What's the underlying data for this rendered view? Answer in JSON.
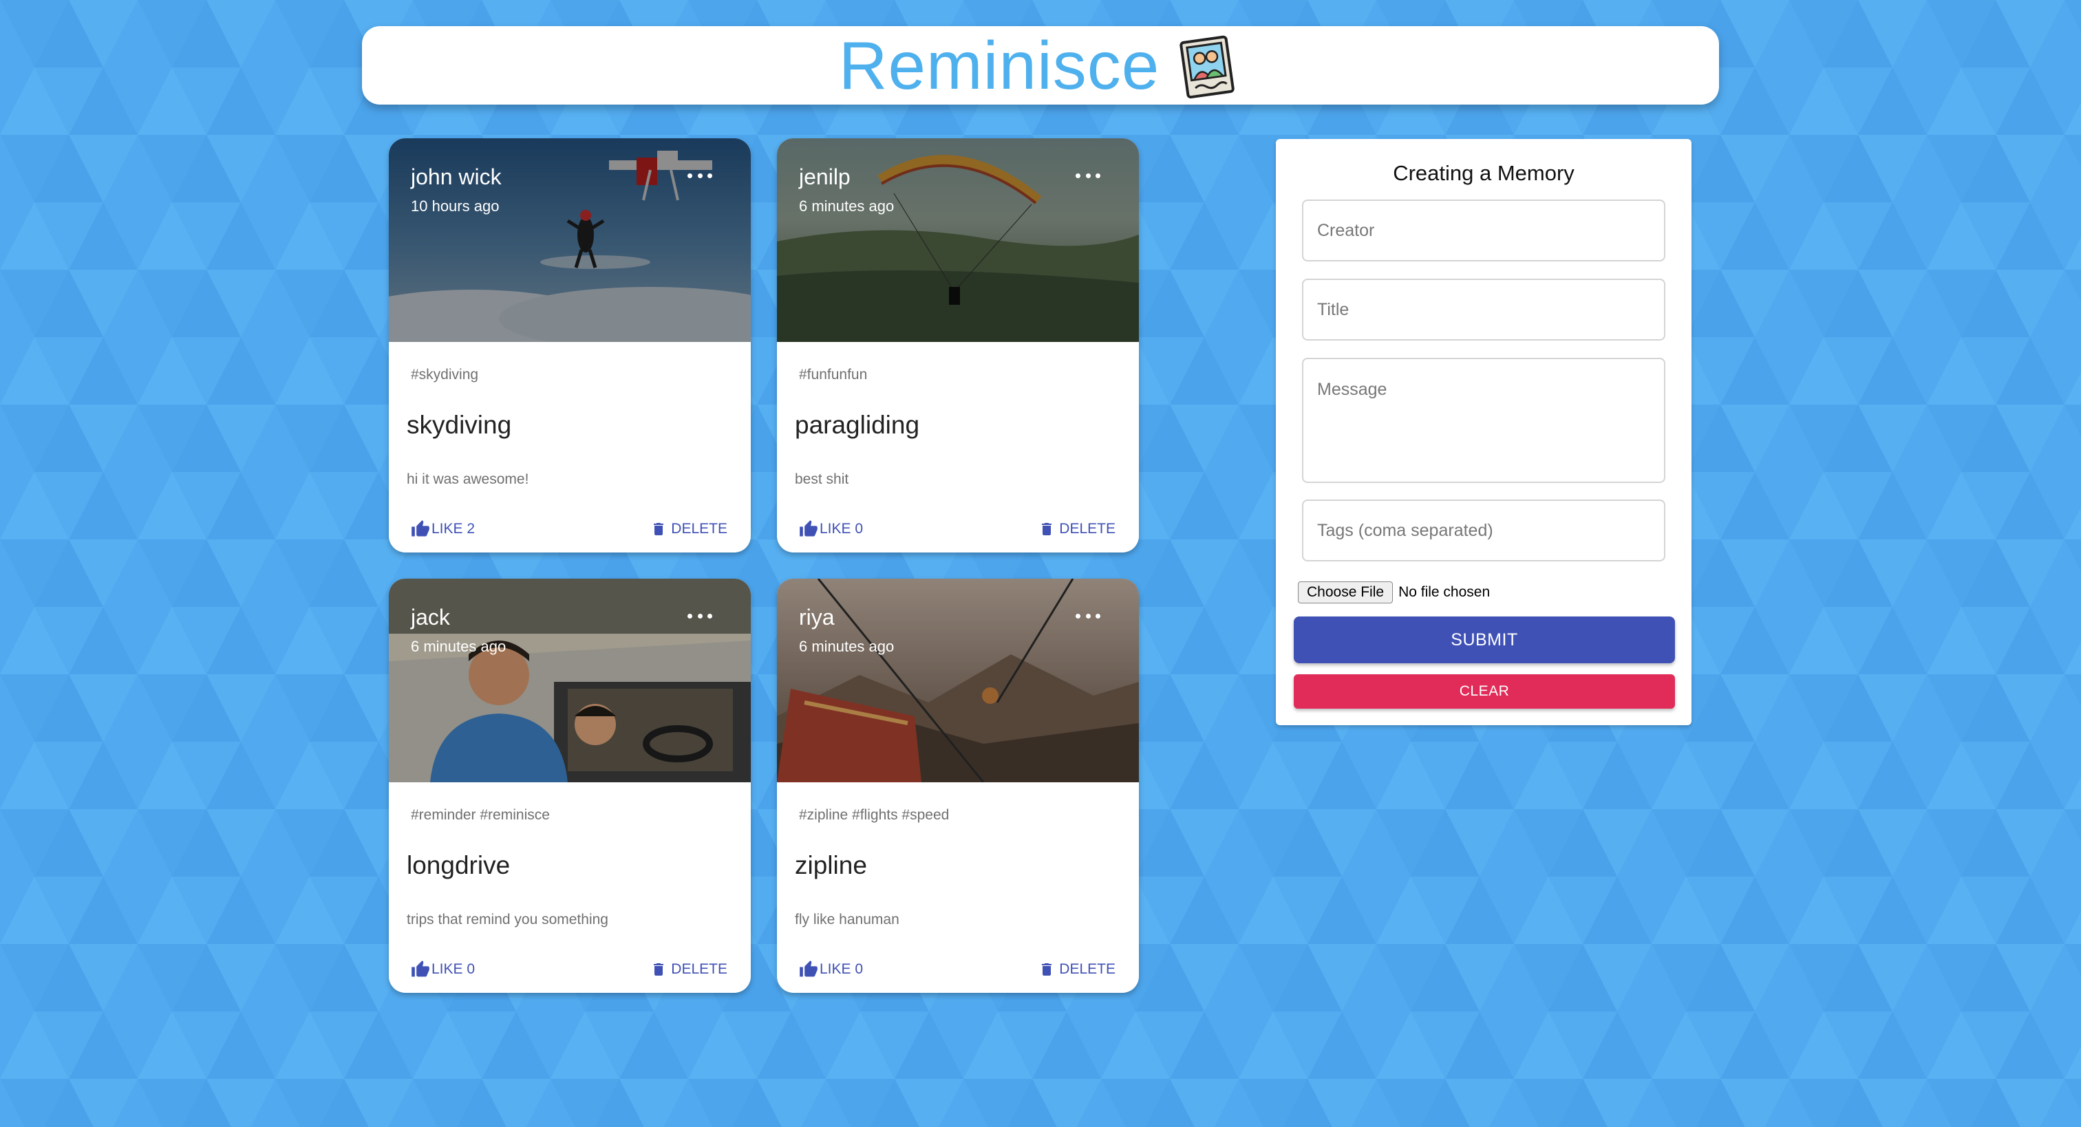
{
  "app": {
    "title": "Reminisce"
  },
  "colors": {
    "background": "#51aaef",
    "brand": "#4fb0ee",
    "primary": "#3f51b5",
    "secondary": "#e12c5a"
  },
  "posts": [
    {
      "creator": "john wick",
      "time": "10 hours ago",
      "tags": "#skydiving",
      "title": "skydiving",
      "message": "hi it was awesome!",
      "like_label": "LIKE 2",
      "delete_label": "DELETE",
      "image_subject": "skydiver jumping from plane above clouds"
    },
    {
      "creator": "jenilp",
      "time": "6 minutes ago",
      "tags": "#funfunfun",
      "title": "paragliding",
      "message": "best shit",
      "like_label": "LIKE 0",
      "delete_label": "DELETE",
      "image_subject": "paraglider over valley"
    },
    {
      "creator": "jack",
      "time": "6 minutes ago",
      "tags": "#reminder #reminisce",
      "title": "longdrive",
      "message": "trips that remind you something",
      "like_label": "LIKE 0",
      "delete_label": "DELETE",
      "image_subject": "friends taking selfie from car window"
    },
    {
      "creator": "riya",
      "time": "6 minutes ago",
      "tags": "#zipline #flights #speed",
      "title": "zipline",
      "message": "fly like hanuman",
      "like_label": "LIKE 0",
      "delete_label": "DELETE",
      "image_subject": "person on zipline over mountains"
    }
  ],
  "form": {
    "heading": "Creating a Memory",
    "creator_placeholder": "Creator",
    "title_placeholder": "Title",
    "message_placeholder": "Message",
    "tags_placeholder": "Tags (coma separated)",
    "file_button": "Choose File",
    "file_status": "No file chosen",
    "submit_label": "SUBMIT",
    "clear_label": "CLEAR"
  }
}
